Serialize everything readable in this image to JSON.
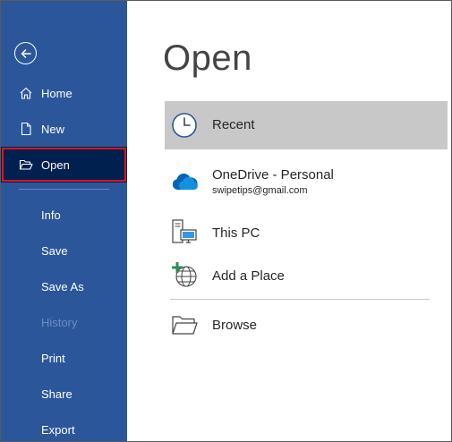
{
  "sidebar": {
    "back_label": "Back",
    "items": [
      {
        "label": "Home",
        "icon": "home-icon"
      },
      {
        "label": "New",
        "icon": "new-document-icon"
      },
      {
        "label": "Open",
        "icon": "folder-open-icon"
      },
      {
        "label": "Info"
      },
      {
        "label": "Save"
      },
      {
        "label": "Save As"
      },
      {
        "label": "History"
      },
      {
        "label": "Print"
      },
      {
        "label": "Share"
      },
      {
        "label": "Export"
      }
    ]
  },
  "main": {
    "title": "Open",
    "locations": [
      {
        "name": "Recent",
        "icon": "clock-icon"
      },
      {
        "name": "OneDrive - Personal",
        "account": "swipetips@gmail.com",
        "icon": "onedrive-cloud-icon"
      },
      {
        "name": "This PC",
        "icon": "computer-icon"
      },
      {
        "name": "Add a Place",
        "icon": "add-place-globe-icon"
      },
      {
        "name": "Browse",
        "icon": "folder-icon"
      }
    ]
  },
  "colors": {
    "sidebar_bg": "#2b579a",
    "sidebar_active_bg": "#002050",
    "highlight_border": "#e0131a",
    "selected_row_bg": "#c8c8c8",
    "onedrive_blue": "#0364b8"
  }
}
